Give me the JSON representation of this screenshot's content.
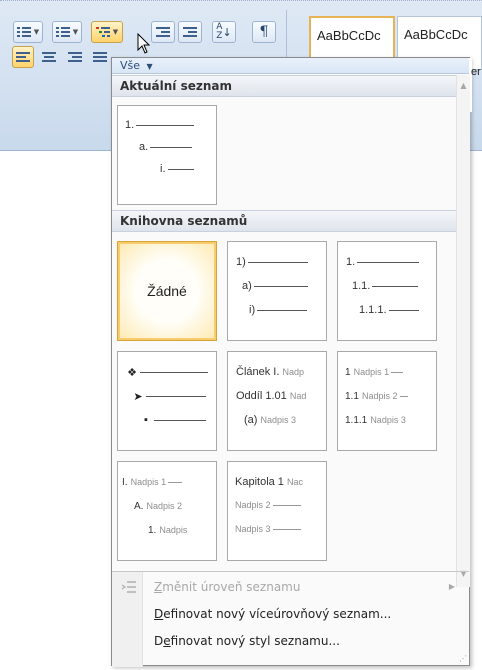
{
  "ribbon": {
    "style_tiles": [
      "AaBbCcDc",
      "AaBbCcDc"
    ],
    "style_tile_partial": "er"
  },
  "dropdown": {
    "filter_label": "Vše",
    "current_section": {
      "title": "Aktuální seznam",
      "tile_lines": [
        "1.",
        "a.",
        "i."
      ]
    },
    "library_section": {
      "title": "Knihovna seznamů",
      "tiles": [
        {
          "label": "Žádné"
        },
        {
          "lines": [
            "1)",
            "a)",
            "i)"
          ]
        },
        {
          "lines": [
            "1.",
            "1.1.",
            "1.1.1."
          ]
        },
        {
          "glyphs": [
            "❖",
            "➤",
            "▪"
          ]
        },
        {
          "lines": [
            {
              "prefix": "Článek I.",
              "muted": "Nadp"
            },
            {
              "prefix": "Oddíl 1.01",
              "muted": "Nad"
            },
            {
              "prefix": "(a)",
              "muted": "Nadpis 3"
            }
          ]
        },
        {
          "lines": [
            {
              "prefix": "1",
              "muted": "Nadpis 1"
            },
            {
              "prefix": "1.1",
              "muted": "Nadpis 2"
            },
            {
              "prefix": "1.1.1",
              "muted": "Nadpis 3"
            }
          ]
        },
        {
          "lines": [
            {
              "prefix": "I.",
              "muted": "Nadpis 1"
            },
            {
              "prefix": "A.",
              "muted": "Nadpis 2"
            },
            {
              "prefix": "1.",
              "muted": "Nadpis"
            }
          ]
        },
        {
          "lines": [
            {
              "prefix": "Kapitola 1",
              "muted": "Nac"
            },
            {
              "prefix": "",
              "muted": "Nadpis 2"
            },
            {
              "prefix": "",
              "muted": "Nadpis 3"
            }
          ]
        }
      ]
    },
    "menu": [
      {
        "label": "Změnit úroveň seznamu",
        "accel": "Z",
        "rest": "měnit úroveň seznamu",
        "disabled": true
      },
      {
        "label": "Definovat nový víceúrovňový seznam...",
        "accel": "D",
        "rest": "efinovat nový víceúrovňový seznam...",
        "disabled": false
      },
      {
        "label": "Definovat nový styl seznamu...",
        "pre": "D",
        "accel": "e",
        "rest": "finovat nový styl seznamu...",
        "disabled": false
      }
    ]
  }
}
